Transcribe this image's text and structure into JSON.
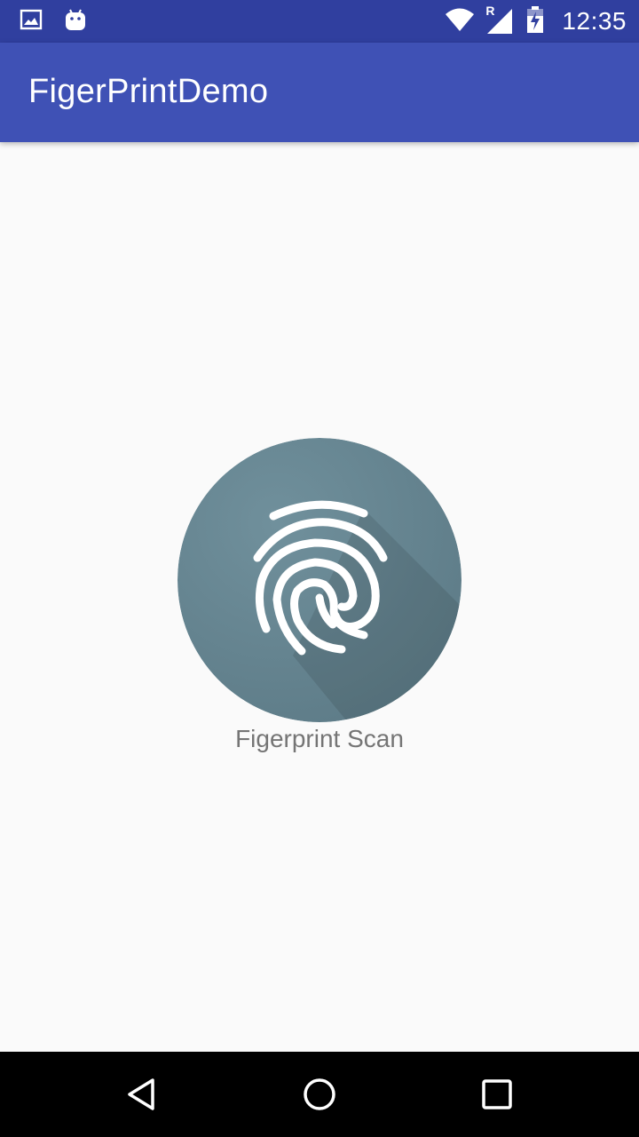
{
  "status_bar": {
    "time": "12:35",
    "icons": [
      "image-notification-icon",
      "android-debug-icon",
      "wifi-icon",
      "signal-roaming-icon",
      "battery-charging-icon"
    ],
    "roaming_label": "R",
    "background": "#303f9f"
  },
  "app_bar": {
    "title": "FigerPrintDemo",
    "background": "#3f51b5"
  },
  "main": {
    "fingerprint_icon": "fingerprint-icon",
    "circle_color": "#607d8b",
    "scan_label": "Figerprint Scan"
  },
  "nav_bar": {
    "buttons": [
      "back-icon",
      "home-icon",
      "recents-icon"
    ]
  }
}
